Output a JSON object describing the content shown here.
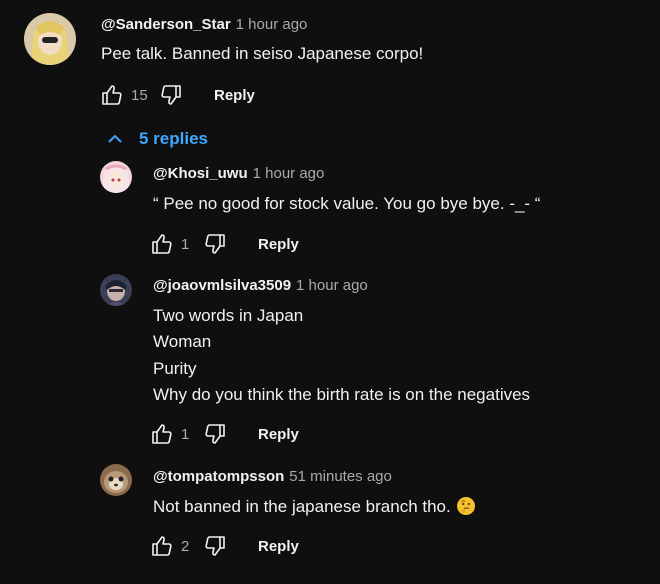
{
  "comment": {
    "author": "@Sanderson_Star",
    "time": "1 hour ago",
    "text": "Pee talk. Banned in seiso Japanese corpo!",
    "likes": "15",
    "reply_label": "Reply"
  },
  "replies_toggle": {
    "label": "5 replies",
    "icon": "chevron-up-icon"
  },
  "replies": [
    {
      "author": "@Khosi_uwu",
      "time": "1 hour ago",
      "lines": [
        "“ Pee no good for stock value. You go bye bye. -_- “"
      ],
      "likes": "1",
      "reply_label": "Reply"
    },
    {
      "author": "@joaovmlsilva3509",
      "time": "1 hour ago",
      "lines": [
        "Two words in Japan",
        "Woman",
        "Purity",
        "Why do you think the birth rate is on the negatives"
      ],
      "likes": "1",
      "reply_label": "Reply"
    },
    {
      "author": "@tompatompsson",
      "time": "51 minutes ago",
      "lines": [
        "Not banned in the japanese branch tho."
      ],
      "likes": "2",
      "reply_label": "Reply",
      "emoji": "thinking-face-emoji"
    }
  ],
  "colors": {
    "background": "#0f0f0f",
    "link_blue": "#3ea6ff",
    "secondary_text": "#aaaaaa",
    "primary_text": "#f1f1f1"
  }
}
